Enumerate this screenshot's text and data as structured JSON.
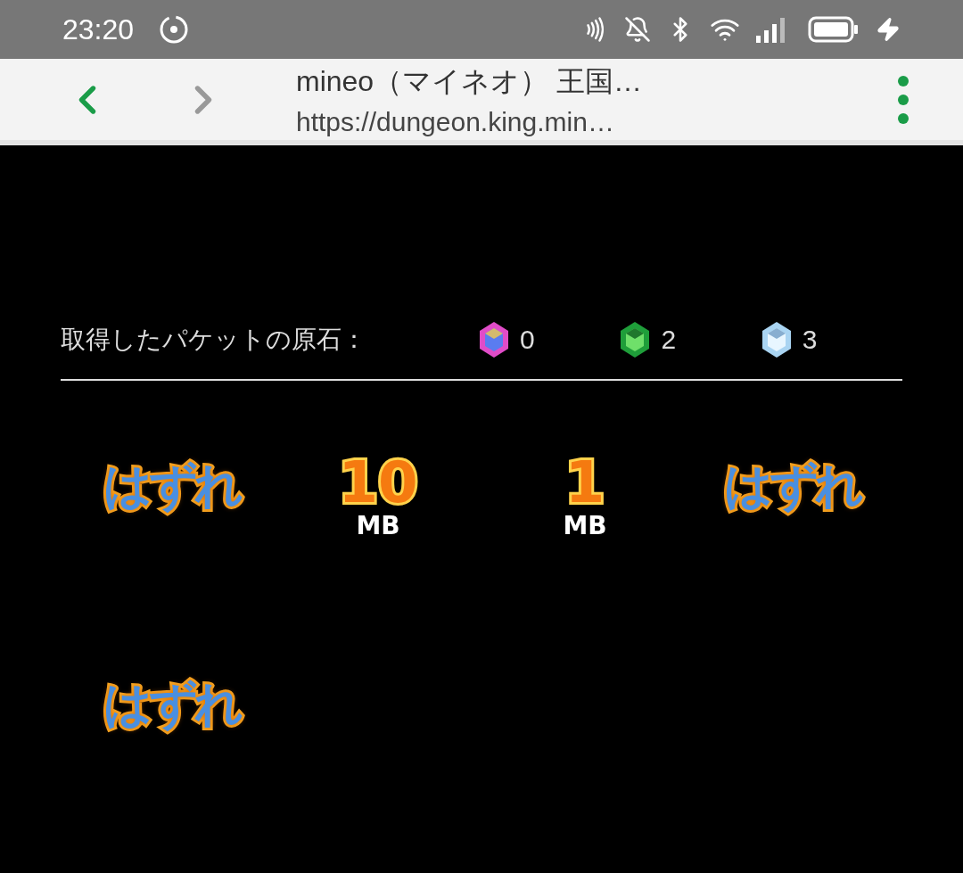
{
  "status_bar": {
    "time": "23:20"
  },
  "browser": {
    "title": "mineo（マイネオ） 王国…",
    "url": "https://dungeon.king.min…"
  },
  "stones": {
    "label": "取得したパケットの原石：",
    "items": [
      {
        "kind": "rainbow",
        "count": "0"
      },
      {
        "kind": "green",
        "count": "2"
      },
      {
        "kind": "ice",
        "count": "3"
      }
    ]
  },
  "results": [
    {
      "kind": "miss",
      "text": "はずれ"
    },
    {
      "kind": "prize",
      "amount": "10",
      "unit": "MB"
    },
    {
      "kind": "prize",
      "amount": "1",
      "unit": "MB"
    },
    {
      "kind": "miss",
      "text": "はずれ"
    },
    {
      "kind": "miss",
      "text": "はずれ"
    }
  ]
}
